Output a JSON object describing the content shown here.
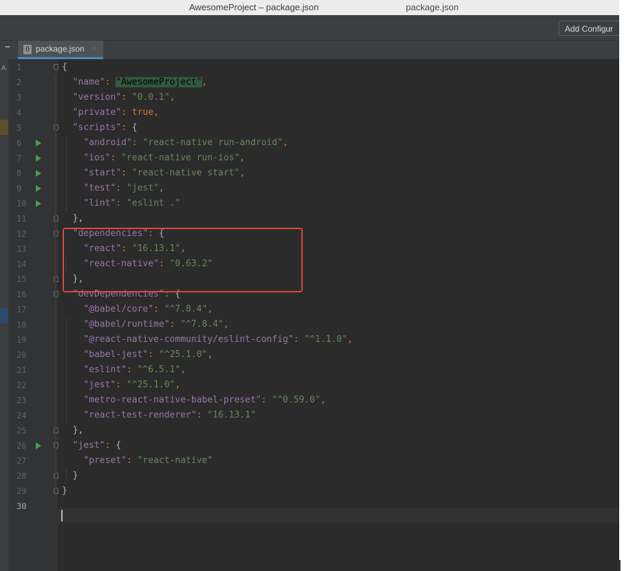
{
  "window": {
    "title": "AwesomeProject – package.json",
    "title_right": "package.json"
  },
  "toolbar": {
    "add_config_label": "Add Configur"
  },
  "tab": {
    "file_icon_text": "{}",
    "label": "package.json",
    "close": "×"
  },
  "left_strip": {
    "text": "A"
  },
  "editor": {
    "current_line": 30,
    "lines": [
      {
        "n": "1",
        "run": false,
        "fold": "down",
        "parts": [
          [
            "b",
            "{"
          ]
        ]
      },
      {
        "n": "2",
        "run": false,
        "fold": "",
        "parts": [
          [
            "b",
            "  "
          ],
          [
            "k",
            "\"name\""
          ],
          [
            "p",
            ": "
          ],
          [
            "hl",
            "\"AwesomeProject\""
          ],
          [
            "p",
            ","
          ]
        ]
      },
      {
        "n": "3",
        "run": false,
        "fold": "",
        "parts": [
          [
            "b",
            "  "
          ],
          [
            "k",
            "\"version\""
          ],
          [
            "p",
            ": "
          ],
          [
            "s",
            "\"0.0.1\""
          ],
          [
            "p",
            ","
          ]
        ]
      },
      {
        "n": "4",
        "run": false,
        "fold": "",
        "parts": [
          [
            "b",
            "  "
          ],
          [
            "k",
            "\"private\""
          ],
          [
            "p",
            ": true,"
          ]
        ]
      },
      {
        "n": "5",
        "run": false,
        "fold": "down",
        "parts": [
          [
            "b",
            "  "
          ],
          [
            "k",
            "\"scripts\""
          ],
          [
            "p",
            ": "
          ],
          [
            "b",
            "{"
          ]
        ]
      },
      {
        "n": "6",
        "run": true,
        "fold": "",
        "parts": [
          [
            "b",
            "    "
          ],
          [
            "k",
            "\"android\""
          ],
          [
            "p",
            ": "
          ],
          [
            "s",
            "\"react-native run-android\""
          ],
          [
            "p",
            ","
          ]
        ]
      },
      {
        "n": "7",
        "run": true,
        "fold": "",
        "parts": [
          [
            "b",
            "    "
          ],
          [
            "k",
            "\"ios\""
          ],
          [
            "p",
            ": "
          ],
          [
            "s",
            "\"react-native run-ios\""
          ],
          [
            "p",
            ","
          ]
        ]
      },
      {
        "n": "8",
        "run": true,
        "fold": "",
        "parts": [
          [
            "b",
            "    "
          ],
          [
            "k",
            "\"start\""
          ],
          [
            "p",
            ": "
          ],
          [
            "s",
            "\"react-native start\""
          ],
          [
            "p",
            ","
          ]
        ]
      },
      {
        "n": "9",
        "run": true,
        "fold": "",
        "parts": [
          [
            "b",
            "    "
          ],
          [
            "k",
            "\"test\""
          ],
          [
            "p",
            ": "
          ],
          [
            "s",
            "\"jest\""
          ],
          [
            "p",
            ","
          ]
        ]
      },
      {
        "n": "10",
        "run": true,
        "fold": "",
        "parts": [
          [
            "b",
            "    "
          ],
          [
            "k",
            "\"lint\""
          ],
          [
            "p",
            ": "
          ],
          [
            "s",
            "\"eslint .\""
          ]
        ]
      },
      {
        "n": "11",
        "run": false,
        "fold": "up",
        "parts": [
          [
            "b",
            "  },"
          ]
        ]
      },
      {
        "n": "12",
        "run": false,
        "fold": "down",
        "parts": [
          [
            "b",
            "  "
          ],
          [
            "k",
            "\"dependencies\""
          ],
          [
            "p",
            ": "
          ],
          [
            "b",
            "{"
          ]
        ]
      },
      {
        "n": "13",
        "run": false,
        "fold": "",
        "parts": [
          [
            "b",
            "    "
          ],
          [
            "k",
            "\"react\""
          ],
          [
            "p",
            ": "
          ],
          [
            "s",
            "\"16.13.1\""
          ],
          [
            "p",
            ","
          ]
        ]
      },
      {
        "n": "14",
        "run": false,
        "fold": "",
        "parts": [
          [
            "b",
            "    "
          ],
          [
            "k",
            "\"react-native\""
          ],
          [
            "p",
            ": "
          ],
          [
            "s",
            "\"0.63.2\""
          ]
        ]
      },
      {
        "n": "15",
        "run": false,
        "fold": "up",
        "parts": [
          [
            "b",
            "  },"
          ]
        ]
      },
      {
        "n": "16",
        "run": false,
        "fold": "down",
        "parts": [
          [
            "b",
            "  "
          ],
          [
            "k",
            "\"devDependencies\""
          ],
          [
            "p",
            ": "
          ],
          [
            "b",
            "{"
          ]
        ]
      },
      {
        "n": "17",
        "run": false,
        "fold": "",
        "parts": [
          [
            "b",
            "    "
          ],
          [
            "k",
            "\"@babel/core\""
          ],
          [
            "p",
            ": "
          ],
          [
            "s",
            "\"^7.8.4\""
          ],
          [
            "p",
            ","
          ]
        ]
      },
      {
        "n": "18",
        "run": false,
        "fold": "",
        "parts": [
          [
            "b",
            "    "
          ],
          [
            "k",
            "\"@babel/runtime\""
          ],
          [
            "p",
            ": "
          ],
          [
            "s",
            "\"^7.8.4\""
          ],
          [
            "p",
            ","
          ]
        ]
      },
      {
        "n": "19",
        "run": false,
        "fold": "",
        "parts": [
          [
            "b",
            "    "
          ],
          [
            "k",
            "\"@react-native-community/eslint-config\""
          ],
          [
            "p",
            ": "
          ],
          [
            "s",
            "\"^1.1.0\""
          ],
          [
            "p",
            ","
          ]
        ]
      },
      {
        "n": "20",
        "run": false,
        "fold": "",
        "parts": [
          [
            "b",
            "    "
          ],
          [
            "k",
            "\"babel-jest\""
          ],
          [
            "p",
            ": "
          ],
          [
            "s",
            "\"^25.1.0\""
          ],
          [
            "p",
            ","
          ]
        ]
      },
      {
        "n": "21",
        "run": false,
        "fold": "",
        "parts": [
          [
            "b",
            "    "
          ],
          [
            "k",
            "\"eslint\""
          ],
          [
            "p",
            ": "
          ],
          [
            "s",
            "\"^6.5.1\""
          ],
          [
            "p",
            ","
          ]
        ]
      },
      {
        "n": "22",
        "run": false,
        "fold": "",
        "parts": [
          [
            "b",
            "    "
          ],
          [
            "k",
            "\"jest\""
          ],
          [
            "p",
            ": "
          ],
          [
            "s",
            "\"^25.1.0\""
          ],
          [
            "p",
            ","
          ]
        ]
      },
      {
        "n": "23",
        "run": false,
        "fold": "",
        "parts": [
          [
            "b",
            "    "
          ],
          [
            "k",
            "\"metro-react-native-babel-preset\""
          ],
          [
            "p",
            ": "
          ],
          [
            "s",
            "\"^0.59.0\""
          ],
          [
            "p",
            ","
          ]
        ]
      },
      {
        "n": "24",
        "run": false,
        "fold": "",
        "parts": [
          [
            "b",
            "    "
          ],
          [
            "k",
            "\"react-test-renderer\""
          ],
          [
            "p",
            ": "
          ],
          [
            "s",
            "\"16.13.1\""
          ]
        ]
      },
      {
        "n": "25",
        "run": false,
        "fold": "up",
        "parts": [
          [
            "b",
            "  },"
          ]
        ]
      },
      {
        "n": "26",
        "run": true,
        "fold": "down",
        "parts": [
          [
            "b",
            "  "
          ],
          [
            "k",
            "\"jest\""
          ],
          [
            "p",
            ": "
          ],
          [
            "b",
            "{"
          ]
        ]
      },
      {
        "n": "27",
        "run": false,
        "fold": "",
        "parts": [
          [
            "b",
            "    "
          ],
          [
            "k",
            "\"preset\""
          ],
          [
            "p",
            ": "
          ],
          [
            "s",
            "\"react-native\""
          ]
        ]
      },
      {
        "n": "28",
        "run": false,
        "fold": "up",
        "parts": [
          [
            "b",
            "  }"
          ]
        ]
      },
      {
        "n": "29",
        "run": false,
        "fold": "up",
        "parts": [
          [
            "b",
            "}"
          ]
        ]
      },
      {
        "n": "30",
        "run": false,
        "fold": "",
        "parts": []
      }
    ]
  },
  "colors": {
    "editor_bg": "#2b2b2b",
    "key": "#9876aa",
    "string": "#6a8759",
    "punct": "#cc7832",
    "highlight": "#32593d",
    "annotation_box": "#e0483b"
  }
}
